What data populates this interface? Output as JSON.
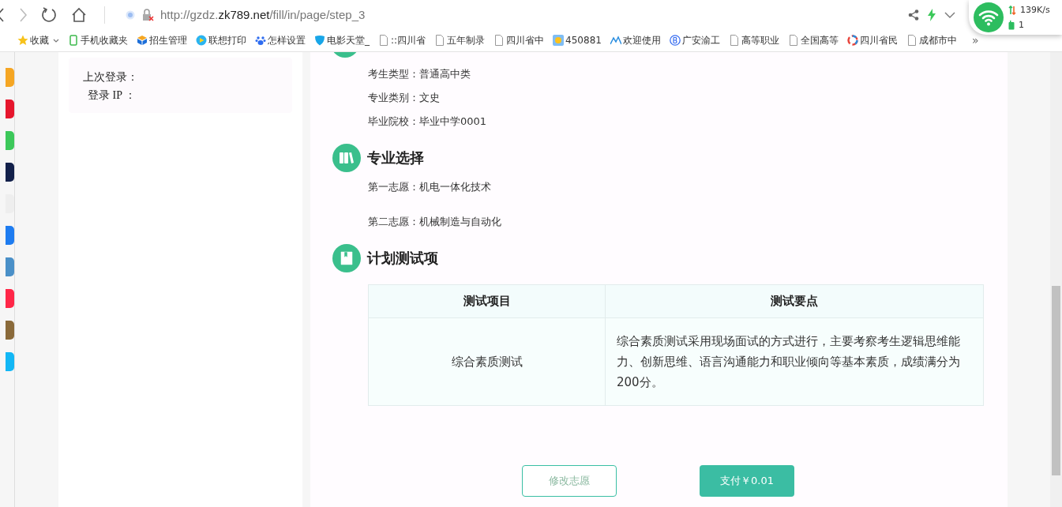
{
  "browser": {
    "url_host": "http://gzdz.",
    "url_domain": "zk789.net",
    "url_path": "/fill/in/page/step_3"
  },
  "bookmarks": [
    {
      "label": "收藏",
      "kind": "star"
    },
    {
      "label": "手机收藏夹",
      "kind": "phone"
    },
    {
      "label": "招生管理",
      "kind": "cube"
    },
    {
      "label": "联想打印",
      "kind": "play"
    },
    {
      "label": "怎样设置",
      "kind": "paw"
    },
    {
      "label": "电影天堂_",
      "kind": "shield"
    },
    {
      "label": "::四川省",
      "kind": "page"
    },
    {
      "label": "五年制录",
      "kind": "page"
    },
    {
      "label": "四川省中",
      "kind": "page"
    },
    {
      "label": "450881",
      "kind": "sun"
    },
    {
      "label": "欢迎使用",
      "kind": "mountain"
    },
    {
      "label": "广安渝工",
      "kind": "circle-b"
    },
    {
      "label": "高等职业",
      "kind": "page"
    },
    {
      "label": "全国高等",
      "kind": "page"
    },
    {
      "label": "四川省民",
      "kind": "ring"
    },
    {
      "label": "成都市中",
      "kind": "page"
    }
  ],
  "bookmarks_more": "»",
  "network_widget": {
    "speed": "139K/s",
    "count": "1"
  },
  "login": {
    "last_login": "上次登录：",
    "ip": "登录 IP ："
  },
  "info_lines": [
    "考生类型：普通高中类",
    "专业类别：文史",
    "毕业院校：毕业中学0001"
  ],
  "sections": [
    {
      "title": "专业选择",
      "kind": "books",
      "lines": [
        "第一志愿：机电一体化技术",
        "第二志愿：机械制造与自动化"
      ]
    },
    {
      "title": "计划测试项",
      "kind": "bookmark"
    }
  ],
  "table": {
    "columns": [
      "测试项目",
      "测试要点"
    ],
    "rows": [
      [
        "综合素质测试",
        "综合素质测试采用现场面试的方式进行，主要考察考生逻辑思维能力、创新思维、语言沟通能力和职业倾向等基本素质，成绩满分为200分。"
      ]
    ]
  },
  "buttons": [
    {
      "label": "修改志愿",
      "kind": "outline"
    },
    {
      "label": "支付￥0.01",
      "kind": "primary"
    }
  ]
}
